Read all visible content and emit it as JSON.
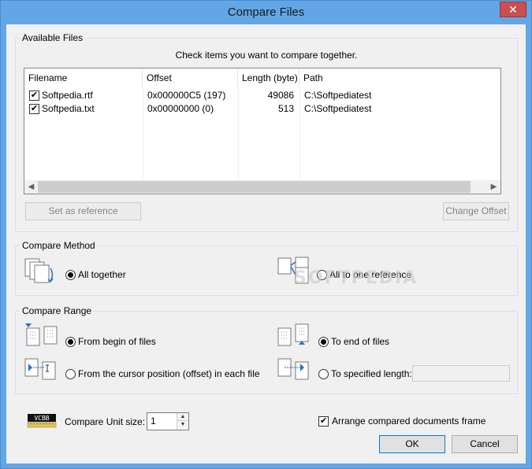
{
  "window": {
    "title": "Compare Files",
    "close_glyph": "✕"
  },
  "available_files": {
    "group_label": "Available Files",
    "hint": "Check items you want to compare together.",
    "columns": [
      "Filename",
      "Offset",
      "Length (byte)",
      "Path"
    ],
    "rows": [
      {
        "checked": true,
        "filename": "Softpedia.rtf",
        "offset": "0x000000C5 (197)",
        "length": "49086",
        "path": "C:\\Softpediatest"
      },
      {
        "checked": true,
        "filename": "Softpedia.txt",
        "offset": "0x00000000 (0)",
        "length": "513",
        "path": "C:\\Softpediatest"
      }
    ],
    "set_reference_label": "Set as reference",
    "change_offset_label": "Change Offset"
  },
  "compare_method": {
    "group_label": "Compare Method",
    "all_together_label": "All together",
    "all_to_one_label": "All to one reference",
    "selected": "all_together"
  },
  "compare_range": {
    "group_label": "Compare Range",
    "from_begin_label": "From begin of files",
    "to_end_label": "To end of files",
    "from_cursor_label": "From the cursor position (offset) in each file",
    "to_length_label": "To specified length:",
    "specified_length_value": "",
    "start_selected": "from_begin",
    "end_selected": "to_end"
  },
  "footer": {
    "unit_icon_text": "VCBB",
    "compare_unit_label": "Compare Unit size:",
    "compare_unit_value": "1",
    "arrange_label": "Arrange compared documents frame",
    "arrange_checked": true,
    "ok_label": "OK",
    "cancel_label": "Cancel"
  },
  "watermark": "SOFTPEDIA",
  "colors": {
    "title_bar": "#62a6e6",
    "close_button": "#c75050",
    "dialog_bg": "#f0f0f0",
    "accent": "#0078d7"
  }
}
